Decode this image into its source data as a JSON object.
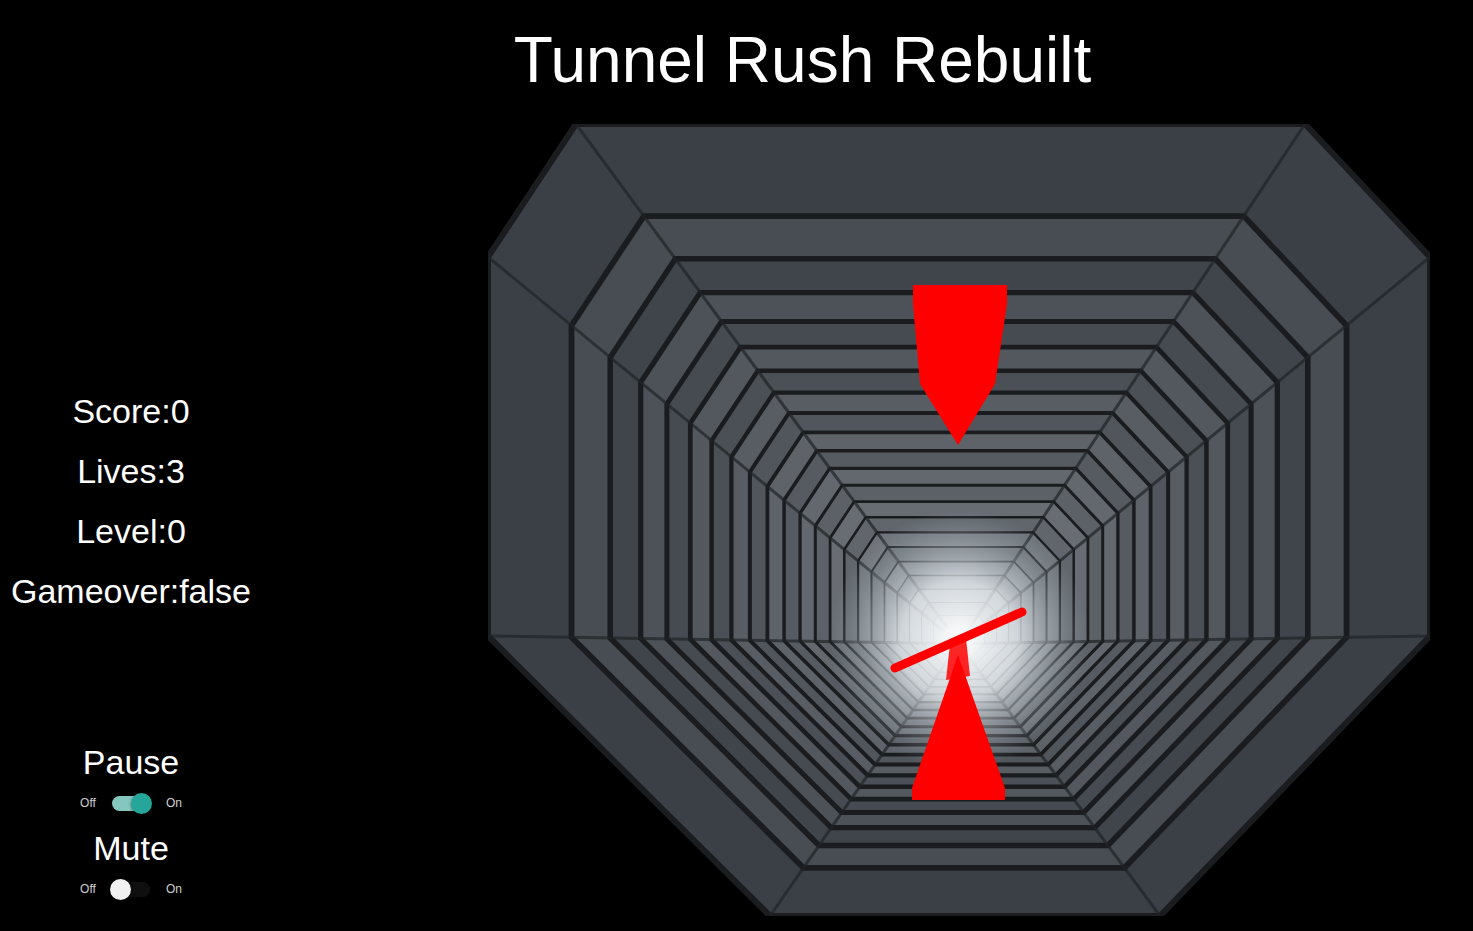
{
  "title": "Tunnel Rush Rebuilt",
  "stats": [
    "Score:0",
    "Lives:3",
    "Level:0",
    "Gameover:false"
  ],
  "toggles": [
    {
      "label": "Pause",
      "off": "Off",
      "on": "On",
      "checked": true
    },
    {
      "label": "Mute",
      "off": "Off",
      "on": "On",
      "checked": false
    }
  ]
}
